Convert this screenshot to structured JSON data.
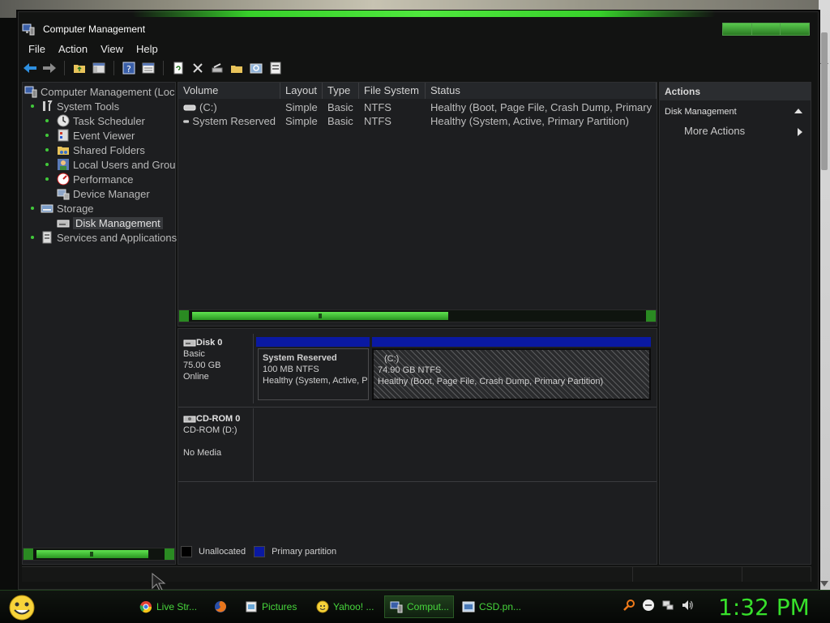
{
  "window": {
    "title": "Computer Management"
  },
  "menu": [
    "File",
    "Action",
    "View",
    "Help"
  ],
  "toolbar_icons": [
    "back-icon",
    "forward-icon",
    "up-folder-icon",
    "show-hide-tree-icon",
    "help-icon",
    "properties-icon",
    "refresh-icon",
    "delete-icon",
    "disk-settings-icon",
    "open-icon",
    "search-icon",
    "export-icon"
  ],
  "tree": {
    "root": "Computer Management (Loc",
    "system_tools": "System Tools",
    "task_scheduler": "Task Scheduler",
    "event_viewer": "Event Viewer",
    "shared_folders": "Shared Folders",
    "local_users": "Local Users and Grou",
    "performance": "Performance",
    "device_manager": "Device Manager",
    "storage": "Storage",
    "disk_management": "Disk Management",
    "services": "Services and Applications"
  },
  "volumes": {
    "headers": [
      "Volume",
      "Layout",
      "Type",
      "File System",
      "Status"
    ],
    "rows": [
      {
        "volume": "(C:)",
        "layout": "Simple",
        "type": "Basic",
        "fs": "NTFS",
        "status": "Healthy (Boot, Page File, Crash Dump, Primary"
      },
      {
        "volume": "System Reserved",
        "layout": "Simple",
        "type": "Basic",
        "fs": "NTFS",
        "status": "Healthy (System, Active, Primary Partition)"
      }
    ]
  },
  "disks": {
    "disk0": {
      "name": "Disk 0",
      "type": "Basic",
      "size": "75.00 GB",
      "state": "Online",
      "p1": {
        "name": "System Reserved",
        "size": "100 MB NTFS",
        "status": "Healthy (System, Active, P"
      },
      "p2": {
        "name": "(C:)",
        "size": "74.90 GB NTFS",
        "status": "Healthy (Boot, Page File, Crash Dump, Primary Partition)"
      }
    },
    "cdrom0": {
      "name": "CD-ROM 0",
      "type": "CD-ROM (D:)",
      "state": "No Media"
    }
  },
  "legend": {
    "unallocated": "Unallocated",
    "primary": "Primary partition",
    "unallocated_color": "#000000",
    "primary_color": "#0a19a2"
  },
  "actions": {
    "header": "Actions",
    "section": "Disk Management",
    "more": "More Actions"
  },
  "taskbar": {
    "items": [
      "Live Str...",
      "",
      "Pictures",
      "Yahoo! ...",
      "Comput...",
      "CSD.pn..."
    ],
    "clock": "1:32 PM"
  },
  "colors": {
    "accent": "#37e02b",
    "panel": "#1d1e20"
  }
}
